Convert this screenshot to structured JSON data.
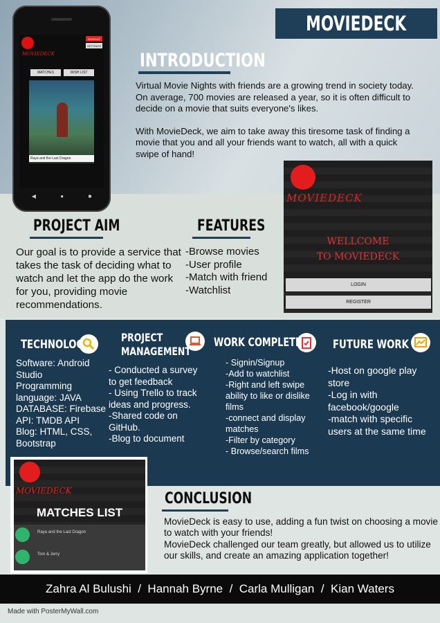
{
  "title": "MOVIEDECK",
  "phone": {
    "brand": "MOVIEDECK",
    "signout_label": "SIGNOUT",
    "settings_label": "SETTINGS",
    "tab_matches": "MATCHES",
    "tab_wishlist": "WISH LIST",
    "movie_caption": "Raya and the Last Dragon"
  },
  "introduction": {
    "heading": "INTRODUCTION",
    "paragraph1": "Virtual Movie Nights with friends are a growing trend in society today. On average, 700 movies are released a year, so it is often difficult to decide on a movie that suits everyone's likes.",
    "paragraph2": "With MovieDeck, we aim to take away this tiresome task of finding a movie that you and all your friends want to watch, all with a quick swipe of hand!"
  },
  "welcome_screen": {
    "brand": "MOVIEDECK",
    "line1": "WELLCOME",
    "line2": "TO MOVIEDECK",
    "login_label": "LOGIN",
    "register_label": "REGISTER"
  },
  "project_aim": {
    "heading": "PROJECT AIM",
    "text": "Our goal is to provide a service that takes the task of deciding what to watch and let the app do the work for you, providing movie recommendations."
  },
  "features": {
    "heading": "FEATURES",
    "items": [
      "-Browse movies",
      "-User profile",
      "-Match with friend",
      "-Watchlist"
    ]
  },
  "technology": {
    "heading": "TECHNOLOGY",
    "lines": [
      "Software:  Android Studio",
      "Programming language: JAVA",
      "DATABASE: Firebase",
      "API: TMDB API",
      "Blog: HTML, CSS, Bootstrap"
    ]
  },
  "project_management": {
    "heading_line1": "PROJECT",
    "heading_line2": "MANAGEMENT",
    "lines": [
      "- Conducted a survey to get feedback",
      "- Using Trello to track ideas and progress.",
      "-Shared code on GitHub.",
      "-Blog to document"
    ]
  },
  "work_completed": {
    "heading": "WORK COMPLETED",
    "lines": [
      "- Signin/Signup",
      "-Add to watchlist",
      " -Right and left swipe ability to like or dislike films",
      "-connect and display matches",
      "-Filter by category",
      "- Browse/search films"
    ]
  },
  "future_work": {
    "heading": "FUTURE WORK",
    "lines": [
      "-Host on google play store",
      "-Log in with facebook/google",
      "-match with specific users at the same time"
    ]
  },
  "matches_screen": {
    "brand": "MOVIEDECK",
    "title": "MATCHES LIST",
    "rows": [
      "Raya and the Last Dragon",
      "Tom & Jerry"
    ]
  },
  "conclusion": {
    "heading": "CONCLUSION",
    "paragraph1": "MovieDeck is easy to use, adding a fun twist on choosing a movie to watch with your friends!",
    "paragraph2": "MovieDeck challenged our team greatly, but allowed us to utilize our skills, and create an amazing application together!"
  },
  "authors": "Zahra Al Bulushi  /  Hannah Byrne  /  Carla Mulligan  /  Kian Waters",
  "credit": "Made with PosterMyWall.com",
  "colors": {
    "navy": "#1b3a52",
    "title_bg": "#1f3f59",
    "brand_red": "#e31d1d"
  },
  "icons": [
    "popcorn-icon",
    "magnifier-icon",
    "laptop-icon",
    "clipboard-check-icon",
    "chart-icon",
    "android-icon"
  ]
}
